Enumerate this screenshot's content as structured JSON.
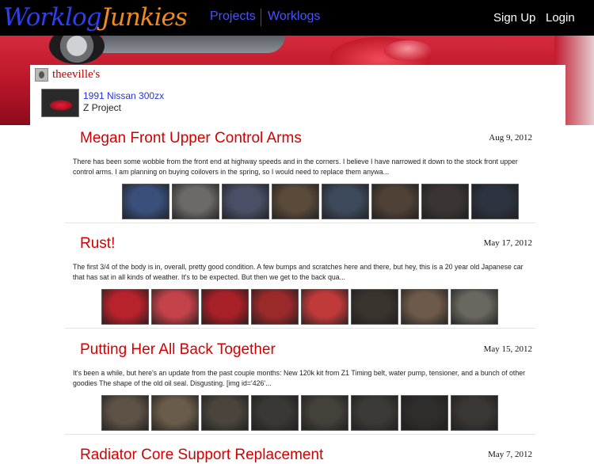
{
  "header": {
    "logo_part1": "Worklog",
    "logo_part2": "Junkies",
    "nav": [
      {
        "label": "Projects"
      },
      {
        "label": "Worklogs"
      }
    ],
    "signup_label": "Sign Up",
    "login_label": "Login"
  },
  "owner": {
    "name": "theeville's"
  },
  "project": {
    "name": "1991 Nissan 300zx",
    "subtitle": "Z Project"
  },
  "posts": [
    {
      "title": "Megan Front Upper Control Arms",
      "date": "Aug 9, 2012",
      "excerpt": "There has been some wobble from the front end at highway speeds and in the corners. I believe I have narrowed it down to the stock front upper control arms. I am planning on buying coilovers in the spring, so I would need to replace them anywa...",
      "thumb_colors": [
        "#3a4f7a",
        "#6b6a66",
        "#4a4f66",
        "#5a4a3a",
        "#3d4a5c",
        "#4f4136",
        "#3a3532",
        "#2d3340"
      ]
    },
    {
      "title": "Rust!",
      "date": "May 17, 2012",
      "excerpt": "The first 3/4 of the body is in, overall, pretty good condition. A few bumps and scratches here and there, but hey, this is a 20 year old Japanese car that has sat in all kinds of weather. It's to be expected. But then we get to the back qua...",
      "thumb_colors": [
        "#b8222c",
        "#c4424a",
        "#a82028",
        "#9a2a2a",
        "#c03a3a",
        "#3a342e",
        "#6e5a4a",
        "#6a6660"
      ]
    },
    {
      "title": "Putting Her All Back Together",
      "date": "May 15, 2012",
      "excerpt": "It's been a while, but here's an update from the past couple months: New 120k kit from Z1 Timing belt, water pump, tensioner, and a bunch of other goodies The shape of the old oil seal. Disgusting. [img id='426'...",
      "thumb_colors": [
        "#5e5246",
        "#6a5c4a",
        "#4a443c",
        "#3a3834",
        "#44403a",
        "#3c3a36",
        "#2e2d2c",
        "#3a3634"
      ]
    },
    {
      "title": "Radiator Core Support Replacement",
      "date": "May 7, 2012",
      "excerpt": "",
      "thumb_colors": []
    }
  ]
}
